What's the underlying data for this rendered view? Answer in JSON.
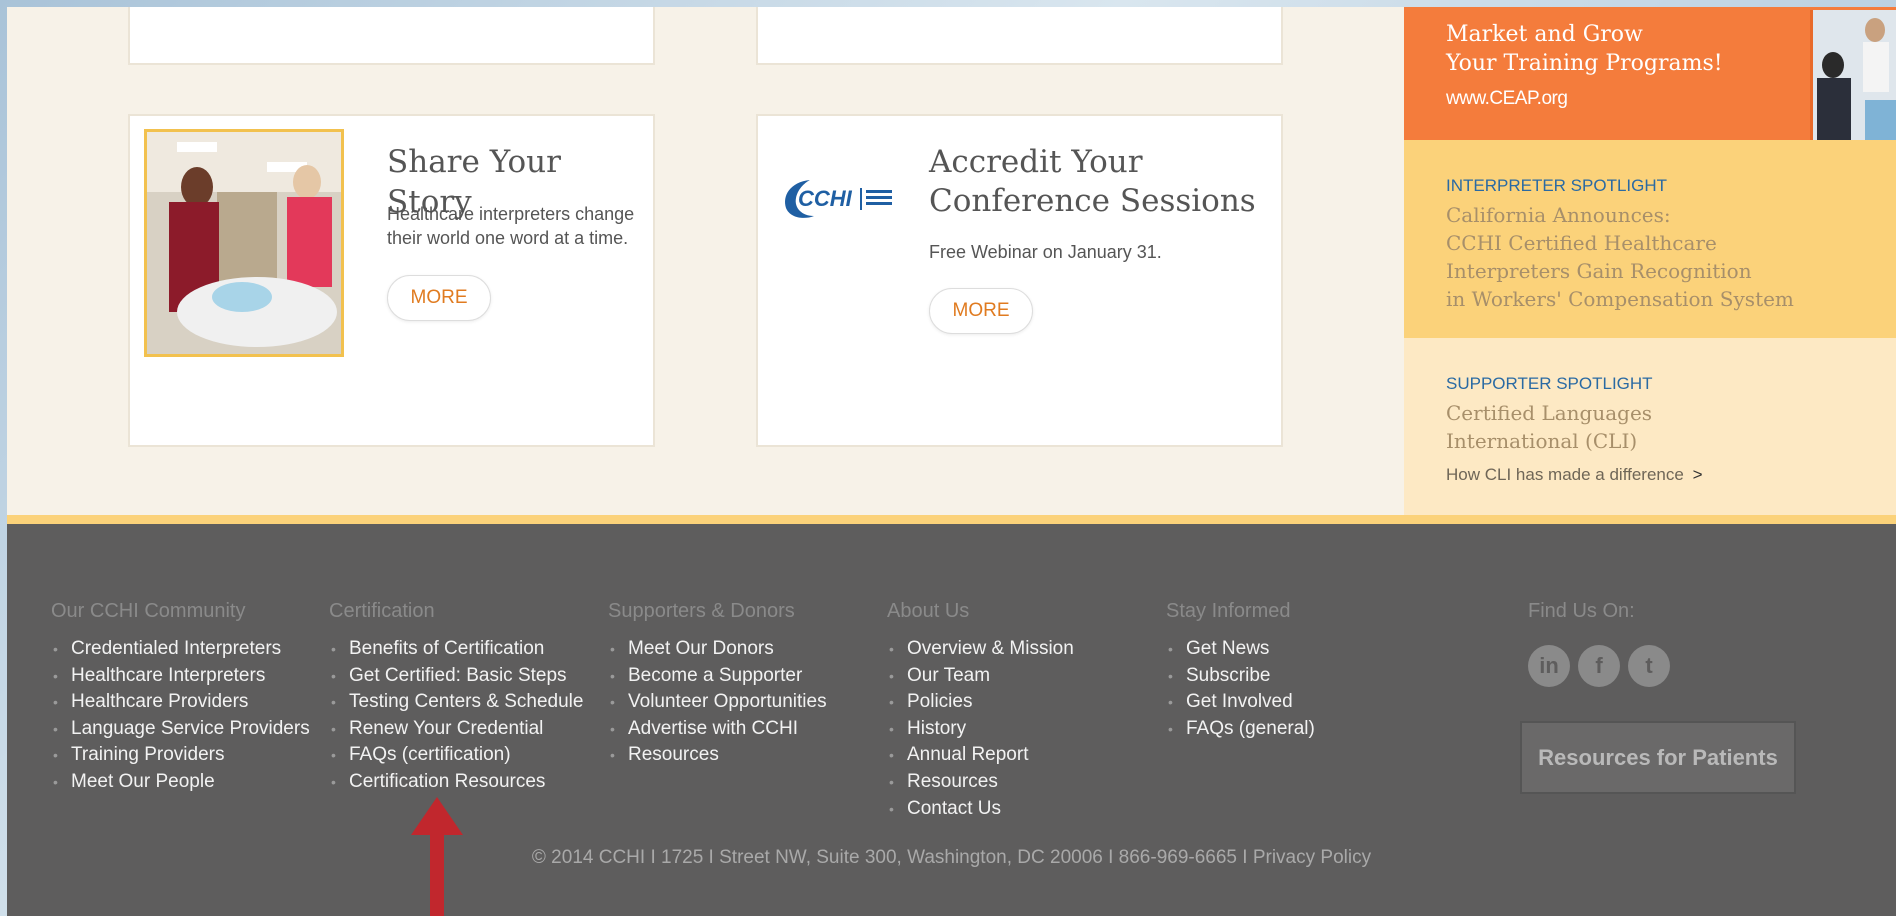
{
  "cards": {
    "story": {
      "title": "Share Your Story",
      "text": "Healthcare interpreters change their world one word at a time.",
      "more": "MORE"
    },
    "accredit": {
      "logo": "CCHI",
      "title_line1": "Accredit Your",
      "title_line2": "Conference Sessions",
      "text": "Free Webinar on January 31.",
      "more": "MORE"
    }
  },
  "sidebar": {
    "promo": {
      "line1": "Market and Grow",
      "line2": "Your Training Programs!",
      "url": "www.CEAP.org"
    },
    "interpreter": {
      "label": "INTERPRETER SPOTLIGHT",
      "lines": [
        "California Announces:",
        "CCHI Certified Healthcare",
        "Interpreters Gain Recognition",
        "in Workers' Compensation System"
      ]
    },
    "supporter": {
      "label": "SUPPORTER SPOTLIGHT",
      "lines": [
        "Certified Languages",
        "International (CLI)"
      ],
      "link": "How CLI has made a difference",
      "link_arrow": ">"
    }
  },
  "footer": {
    "columns": [
      {
        "heading": "Our CCHI Community",
        "items": [
          "Credentialed Interpreters",
          "Healthcare Interpreters",
          "Healthcare Providers",
          "Language Service Providers",
          "Training Providers",
          "Meet Our People"
        ]
      },
      {
        "heading": "Certification",
        "items": [
          "Benefits of Certification",
          "Get Certified: Basic Steps",
          "Testing Centers & Schedule",
          "Renew Your Credential",
          "FAQs (certification)",
          "Certification Resources"
        ]
      },
      {
        "heading": "Supporters & Donors",
        "items": [
          "Meet Our Donors",
          "Become a Supporter",
          "Volunteer Opportunities",
          "Advertise with CCHI",
          "Resources"
        ]
      },
      {
        "heading": "About Us",
        "items": [
          "Overview & Mission",
          "Our Team",
          "Policies",
          "History",
          "Annual Report",
          "Resources",
          "Contact Us"
        ]
      },
      {
        "heading": "Stay Informed",
        "items": [
          "Get News",
          "Subscribe",
          "Get Involved",
          "FAQs (general)"
        ]
      }
    ],
    "find_us": "Find Us On:",
    "social": [
      "in",
      "f",
      "t"
    ],
    "resources_button": "Resources for Patients",
    "copyright": "© 2014 CCHI I 1725 I Street NW, Suite 300, Washington, DC 20006 I 866-969-6665 I Privacy Policy"
  }
}
